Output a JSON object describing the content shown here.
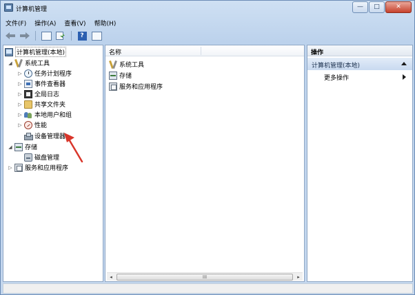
{
  "window": {
    "title": "计算机管理",
    "controls": {
      "minimize": "—",
      "maximize": "□",
      "close": "✕"
    }
  },
  "menu": [
    "文件(F)",
    "操作(A)",
    "查看(V)",
    "帮助(H)"
  ],
  "toolbar": {
    "help_glyph": "?"
  },
  "tree": {
    "root": "计算机管理(本地)",
    "items": [
      {
        "label": "系统工具",
        "expander": "◢"
      },
      {
        "label": "任务计划程序",
        "expander": "▷"
      },
      {
        "label": "事件查看器",
        "expander": "▷"
      },
      {
        "label": "共享文件夹",
        "expander": "▷"
      },
      {
        "label": "本地用户和组",
        "expander": "▷"
      },
      {
        "label": "性能",
        "expander": "▷"
      },
      {
        "label": "设备管理器",
        "expander": ""
      },
      {
        "label": "存储",
        "expander": "◢"
      },
      {
        "label": "磁盘管理",
        "expander": ""
      },
      {
        "label": "服务和应用程序",
        "expander": "▷"
      }
    ],
    "global_log": "全局日志"
  },
  "main": {
    "column_header": "名称",
    "items": [
      "系统工具",
      "存储",
      "服务和应用程序"
    ],
    "scroll": {
      "left": "◂",
      "right": "▸",
      "thumb": "III"
    }
  },
  "actions": {
    "header": "操作",
    "group": "计算机管理(本地)",
    "more": "更多操作"
  },
  "colors": {
    "annotation_arrow": "#d9362b",
    "accent": "#bcd2ec"
  }
}
